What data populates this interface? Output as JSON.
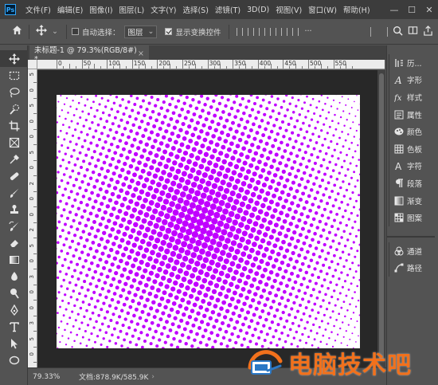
{
  "app": {
    "logo_text": "Ps",
    "menu": [
      "文件(F)",
      "编辑(E)",
      "图像(I)",
      "图层(L)",
      "文字(Y)",
      "选择(S)",
      "滤镜(T)",
      "3D(D)",
      "视图(V)",
      "窗口(W)",
      "帮助(H)"
    ],
    "window_controls": {
      "minimize": "—",
      "maximize": "☐",
      "close": "✕"
    }
  },
  "options_bar": {
    "home_icon": "home-icon",
    "move_icon": "move-icon",
    "auto_select_label": "自动选择：",
    "auto_select_checked": false,
    "auto_select_target": "图层",
    "show_transform_label": "显示变换控件",
    "show_transform_checked": true
  },
  "document": {
    "tab_title": "未标题-1 @ 79.3%(RGB/8#) *",
    "tab_close": "×",
    "halftone_color": "#c000ff"
  },
  "rulers": {
    "horizontal": [
      "0",
      "50",
      "100",
      "150",
      "200",
      "250",
      "300",
      "350",
      "400",
      "450",
      "500",
      "550"
    ],
    "vertical": [
      "5",
      "0",
      "5",
      "0",
      "0",
      "5",
      "0",
      "2",
      "0",
      "0",
      "2",
      "5",
      "0",
      "3",
      "0",
      "0",
      "3",
      "5",
      "0"
    ]
  },
  "status_bar": {
    "zoom": "79.33%",
    "doc_info": "文档:878.9K/585.9K",
    "arrow": "›"
  },
  "panels": {
    "group1": [
      {
        "icon": "history-icon",
        "label": "历..."
      },
      {
        "icon": "character-icon",
        "label": "字形"
      },
      {
        "icon": "styles-icon",
        "label": "样式"
      },
      {
        "icon": "properties-icon",
        "label": "属性"
      },
      {
        "icon": "color-icon",
        "label": "颜色"
      },
      {
        "icon": "swatches-icon",
        "label": "色板"
      },
      {
        "icon": "type-icon",
        "label": "字符"
      },
      {
        "icon": "paragraph-icon",
        "label": "段落"
      },
      {
        "icon": "gradient-icon",
        "label": "渐变"
      },
      {
        "icon": "patterns-icon",
        "label": "图案"
      }
    ],
    "group2": [
      {
        "icon": "channels-icon",
        "label": "通道"
      },
      {
        "icon": "paths-icon",
        "label": "路径"
      }
    ]
  },
  "watermark": {
    "text": "电脑技术吧"
  }
}
